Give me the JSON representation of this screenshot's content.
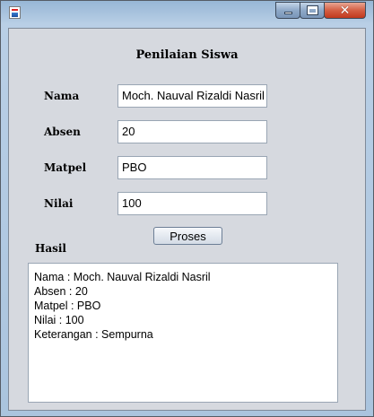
{
  "window": {
    "controls": [
      "minimize-icon",
      "maximize-icon",
      "close-icon"
    ]
  },
  "form": {
    "heading": "Penilaian Siswa",
    "fields": [
      {
        "label": "Nama",
        "value": "Moch. Nauval Rizaldi Nasril"
      },
      {
        "label": "Absen",
        "value": "20"
      },
      {
        "label": "Matpel",
        "value": "PBO"
      },
      {
        "label": "Nilai",
        "value": "100"
      }
    ],
    "button_label": "Proses",
    "result_label": "Hasil",
    "result_lines": [
      "Nama : Moch. Nauval Rizaldi Nasril",
      "Absen : 20",
      "Matpel : PBO",
      "Nilai : 100",
      "Keterangan : Sempurna"
    ]
  }
}
